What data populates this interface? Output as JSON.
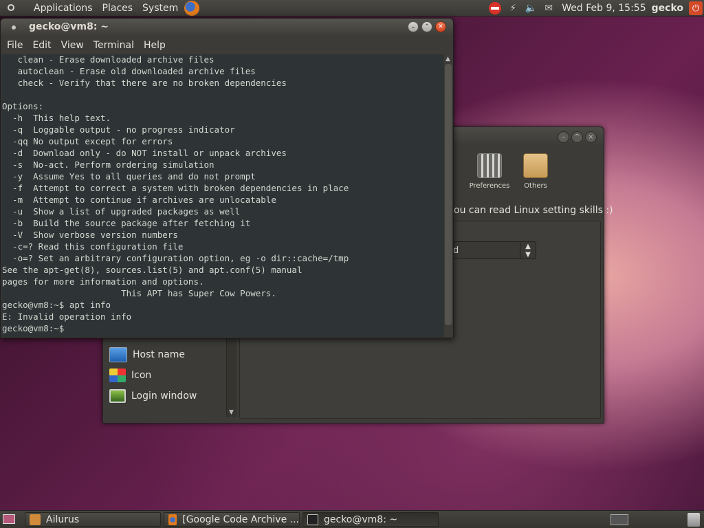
{
  "top_panel": {
    "menus": [
      "Applications",
      "Places",
      "System"
    ],
    "clock": "Wed Feb  9, 15:55",
    "user": "gecko"
  },
  "background_window": {
    "categories": [
      {
        "label": "Preferences",
        "icon": "preferences-icon"
      },
      {
        "label": "Others",
        "icon": "others-icon"
      }
    ],
    "tagline": "ou can read Linux setting skills :)",
    "combo_value": "d",
    "sidebar_items": [
      {
        "label": "Host name",
        "icon": "monitor-icon"
      },
      {
        "label": "Icon",
        "icon": "icon-grid-icon"
      },
      {
        "label": "Login window",
        "icon": "login-screen-icon"
      }
    ]
  },
  "terminal": {
    "title": "gecko@vm8: ~",
    "menus": [
      "File",
      "Edit",
      "View",
      "Terminal",
      "Help"
    ],
    "lines": [
      "   clean - Erase downloaded archive files",
      "   autoclean - Erase old downloaded archive files",
      "   check - Verify that there are no broken dependencies",
      "",
      "Options:",
      "  -h  This help text.",
      "  -q  Loggable output - no progress indicator",
      "  -qq No output except for errors",
      "  -d  Download only - do NOT install or unpack archives",
      "  -s  No-act. Perform ordering simulation",
      "  -y  Assume Yes to all queries and do not prompt",
      "  -f  Attempt to correct a system with broken dependencies in place",
      "  -m  Attempt to continue if archives are unlocatable",
      "  -u  Show a list of upgraded packages as well",
      "  -b  Build the source package after fetching it",
      "  -V  Show verbose version numbers",
      "  -c=? Read this configuration file",
      "  -o=? Set an arbitrary configuration option, eg -o dir::cache=/tmp",
      "See the apt-get(8), sources.list(5) and apt.conf(5) manual",
      "pages for more information and options.",
      "                       This APT has Super Cow Powers.",
      "gecko@vm8:~$ apt info",
      "E: Invalid operation info",
      "gecko@vm8:~$ "
    ]
  },
  "bottom_panel": {
    "tasks": [
      "Ailurus",
      "[Google Code Archive ...",
      "gecko@vm8: ~"
    ]
  }
}
